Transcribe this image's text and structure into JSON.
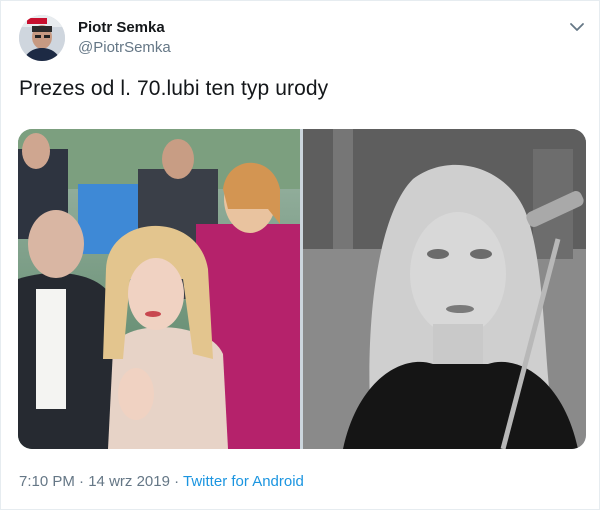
{
  "author": {
    "name": "Piotr Semka",
    "handle": "@PiotrSemka"
  },
  "tweet": {
    "text": "Prezes od l. 70.lubi ten typ urody",
    "time": "7:10 PM",
    "separator": "·",
    "date": "14 wrz 2019",
    "source": "Twitter for Android"
  },
  "icons": {
    "menu": "chevron-down-icon"
  },
  "colors": {
    "link": "#1b95e0",
    "secondary_text": "#657786"
  }
}
